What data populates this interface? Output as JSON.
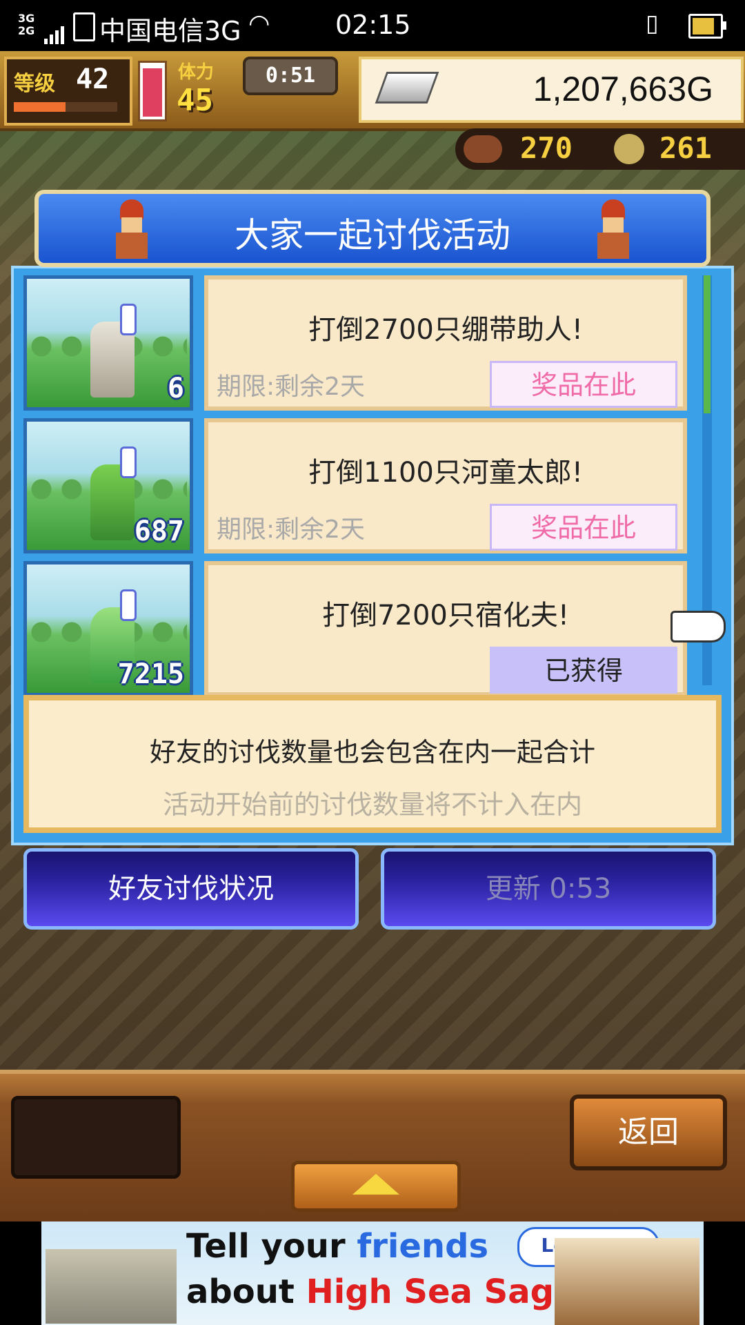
{
  "status_bar": {
    "network": "3G 2G",
    "carrier": "中国电信3G",
    "time": "02:15",
    "battery_icon": "battery-charging-icon",
    "wifi_icon": "wifi-icon"
  },
  "hud": {
    "level_label": "等级",
    "level_value": "42",
    "level_progress": 0.5,
    "stamina_label": "体力",
    "stamina_value": "45",
    "stamina_fill": 0.95,
    "stamina_timer": "0:51",
    "gold": "1,207,663G",
    "resource1": "270",
    "resource2": "261"
  },
  "dialog": {
    "title": "大家一起讨伐活动",
    "quests": [
      {
        "text": "打倒2700只绷带助人!",
        "deadline": "期限:剩余2天",
        "button": "奖品在此",
        "button_state": "prize",
        "count": "6"
      },
      {
        "text": "打倒1100只河童太郎!",
        "deadline": "期限:剩余2天",
        "button": "奖品在此",
        "button_state": "prize",
        "count": "687"
      },
      {
        "text": "打倒7200只宿化夫!",
        "deadline": "",
        "button": "已获得",
        "button_state": "obtained",
        "count": "7215"
      }
    ],
    "note_line1": "好友的讨伐数量也会包含在内一起合计",
    "note_line2": "活动开始前的讨伐数量将不计入在内",
    "friends_button": "好友讨伐状况",
    "refresh_button": "更新 0:53"
  },
  "bottom_bar": {
    "back_button": "返回",
    "up_icon": "up-arrow-icon"
  },
  "ad": {
    "line1_a": "Tell your ",
    "line1_b": "friends",
    "line2_a": "about ",
    "line2_b": "High Sea Saga!",
    "cta": "Let's go!"
  }
}
